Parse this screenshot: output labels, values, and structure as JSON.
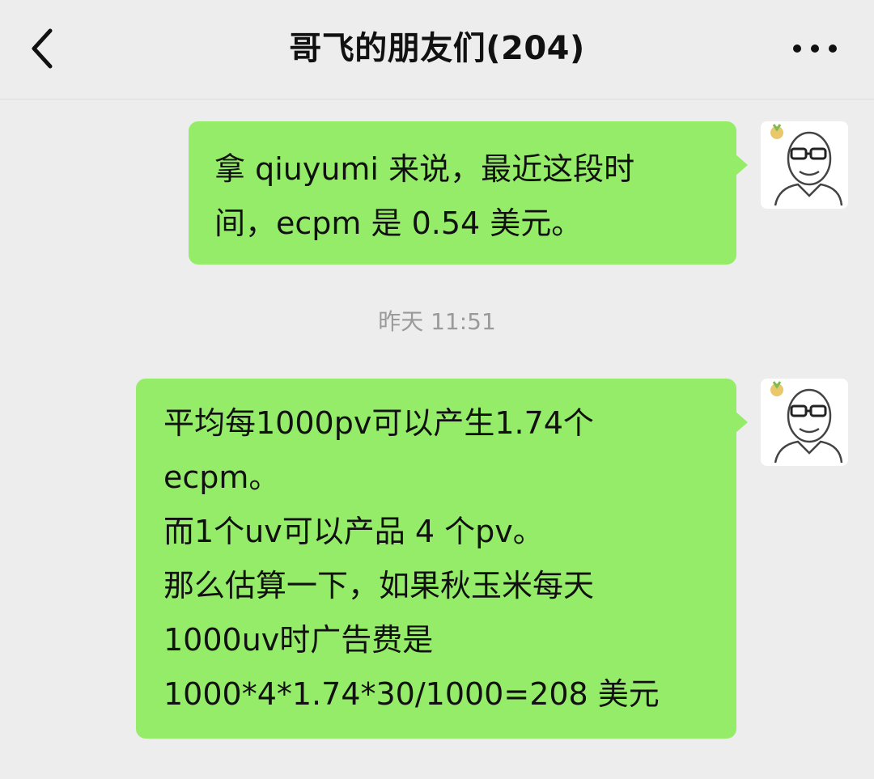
{
  "header": {
    "title": "哥飞的朋友们(204)",
    "back_icon": "chevron-left-icon",
    "more_icon": "more-dots-icon"
  },
  "colors": {
    "background": "#ededed",
    "bubble_self": "#95ec69",
    "timestamp_text": "#9a9a9a",
    "text": "#111111"
  },
  "messages": [
    {
      "sender": "self",
      "lines": [
        "拿 qiuyumi 来说，最近这段时",
        "间，ecpm 是 0.54 美元。"
      ]
    },
    {
      "sender": "self",
      "lines": [
        "平均每1000pv可以产生1.74个",
        "ecpm。",
        "而1个uv可以产品 4 个pv。",
        "那么估算一下，如果秋玉米每天",
        "1000uv时广告费是",
        "1000*4*1.74*30/1000=208 美元"
      ]
    }
  ],
  "timestamp": "昨天 11:51"
}
